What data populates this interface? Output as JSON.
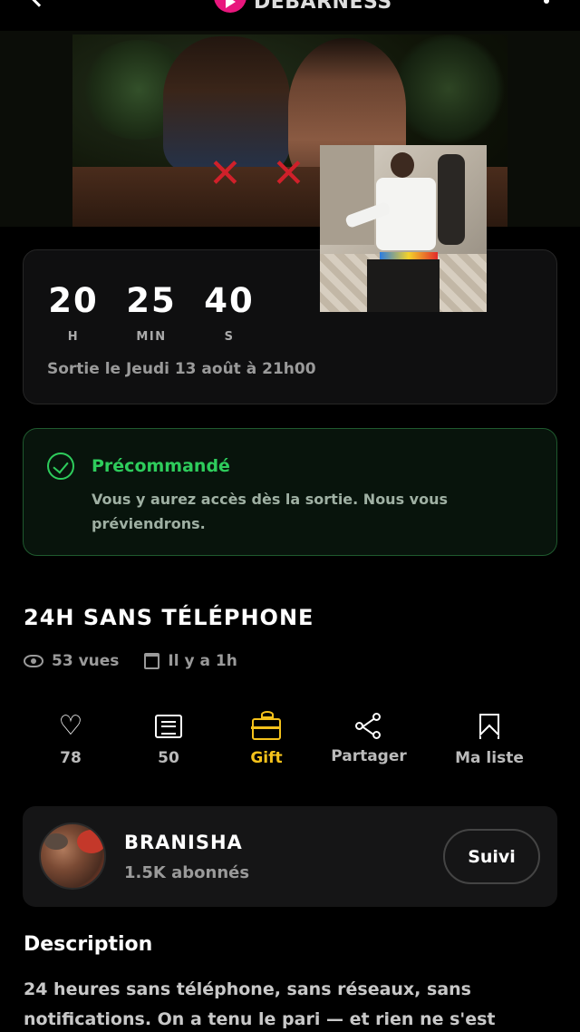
{
  "app": {
    "name": "DEBARNESS",
    "accent": "#e8177d"
  },
  "hero": {
    "image": "video-poster"
  },
  "countdown": {
    "hours": "20",
    "hours_label": "H",
    "minutes": "25",
    "minutes_label": "MIN",
    "seconds": "40",
    "seconds_label": "S",
    "release_text": "Sortie le Jeudi 13 août à 21h00"
  },
  "preorder": {
    "title": "Précommandé",
    "text": "Vous y aurez accès dès la sortie. Nous vous préviendrons.",
    "color": "#2ecc5c"
  },
  "video": {
    "title": "24H SANS TÉLÉPHONE",
    "views": "53 vues",
    "posted": "Il y a 1h"
  },
  "actions": {
    "likes": "78",
    "comments": "50",
    "gift": "Gift",
    "share": "Partager",
    "my_list": "Ma liste",
    "gift_color": "#f5c21b"
  },
  "channel": {
    "name": "BRANISHA",
    "subscribers": "1.5K abonnés",
    "follow_label": "Suivi"
  },
  "description": {
    "heading": "Description",
    "text": "24 heures sans téléphone, sans réseaux, sans notifications. On a tenu le pari — et rien ne s'est"
  }
}
